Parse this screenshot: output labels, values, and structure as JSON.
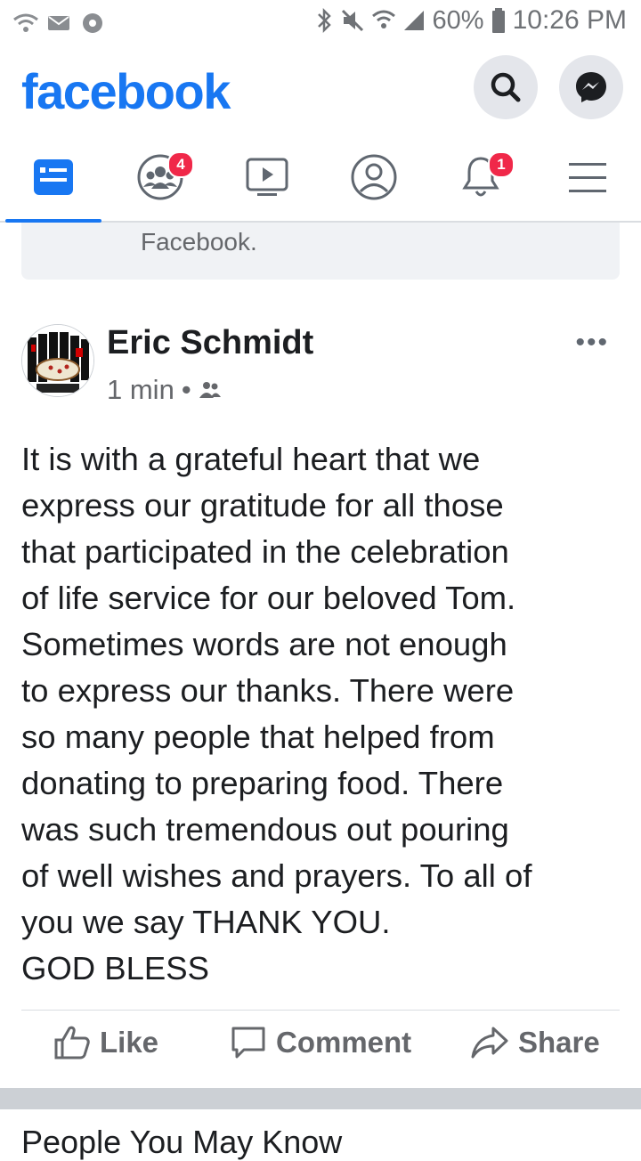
{
  "status": {
    "battery": "60%",
    "time": "10:26 PM"
  },
  "app": {
    "brand": "facebook",
    "brand_color": "#1877f2",
    "icons": [
      "search-icon",
      "messenger-icon"
    ]
  },
  "tabs": [
    {
      "name": "news-feed",
      "active": true
    },
    {
      "name": "groups",
      "badge": "4"
    },
    {
      "name": "watch"
    },
    {
      "name": "profile"
    },
    {
      "name": "notifications",
      "badge": "1"
    },
    {
      "name": "menu"
    }
  ],
  "previous_card": {
    "text": "Facebook."
  },
  "post": {
    "author": "Eric Schmidt",
    "time": "1 min",
    "dot": "•",
    "more": "•••",
    "text": "It is with a grateful heart that we\nexpress our gratitude for all those\nthat participated in the celebration\nof life service  for our beloved Tom.\nSometimes words are not enough\nto express our thanks. There were\nso many people that helped from\ndonating to preparing food. There\nwas such tremendous out pouring\nof well wishes and prayers. To all of\nyou  we say THANK YOU.\nGOD BLESS",
    "actions": {
      "like": "Like",
      "comment": "Comment",
      "share": "Share"
    }
  },
  "next_card": {
    "text": "People You May Know"
  }
}
